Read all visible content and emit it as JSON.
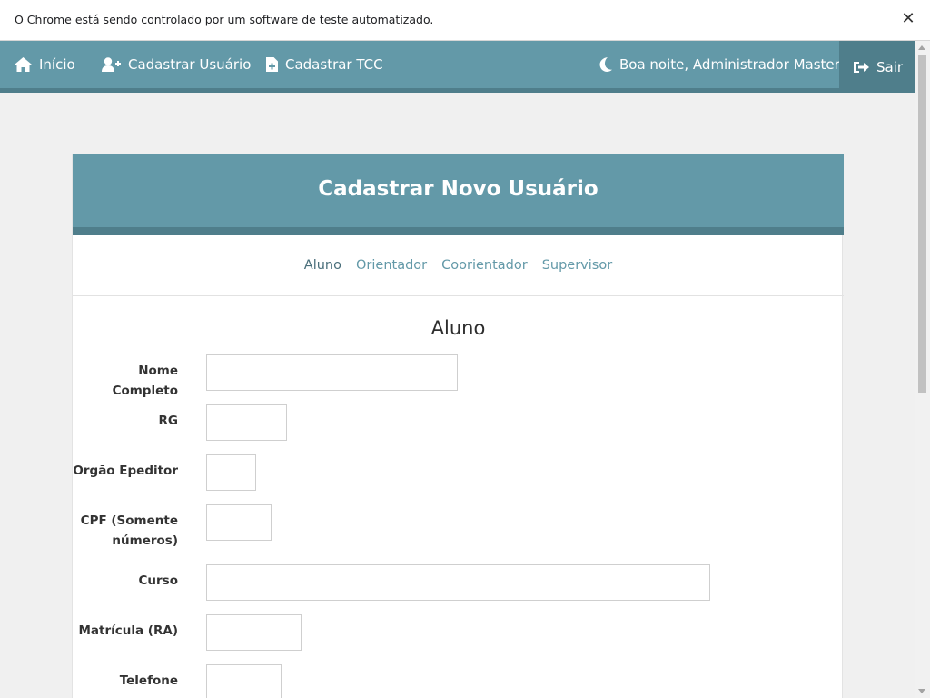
{
  "infobar": {
    "message": "O Chrome está sendo controlado por um software de teste automatizado.",
    "close_glyph": "✕"
  },
  "navbar": {
    "home": "Início",
    "register_user": "Cadastrar Usuário",
    "register_tcc": "Cadastrar TCC",
    "greeting": "Boa noite, Administrador Master!",
    "exit": "Sair"
  },
  "card": {
    "title": "Cadastrar Novo Usuário",
    "tabs": [
      {
        "label": "Aluno",
        "active": true
      },
      {
        "label": "Orientador",
        "active": false
      },
      {
        "label": "Coorientador",
        "active": false
      },
      {
        "label": "Supervisor",
        "active": false
      }
    ],
    "section_title": "Aluno",
    "fields": {
      "nome": {
        "label": "Nome Completo",
        "value": ""
      },
      "rg": {
        "label": "RG",
        "value": ""
      },
      "orgao": {
        "label": "Orgão Epeditor",
        "value": ""
      },
      "cpf": {
        "label": "CPF (Somente números)",
        "value": ""
      },
      "curso": {
        "label": "Curso",
        "value": ""
      },
      "matricula": {
        "label": "Matrícula (RA)",
        "value": ""
      },
      "telefone": {
        "label": "Telefone",
        "value": ""
      }
    }
  },
  "colors": {
    "primary": "#6399a8",
    "primary_dark": "#4f7e8b",
    "background": "#f0f0f0"
  },
  "icons": {
    "home": "home-icon",
    "user_plus": "user-plus-icon",
    "file_plus": "file-plus-icon",
    "moon": "moon-icon",
    "sign_out": "sign-out-icon"
  }
}
